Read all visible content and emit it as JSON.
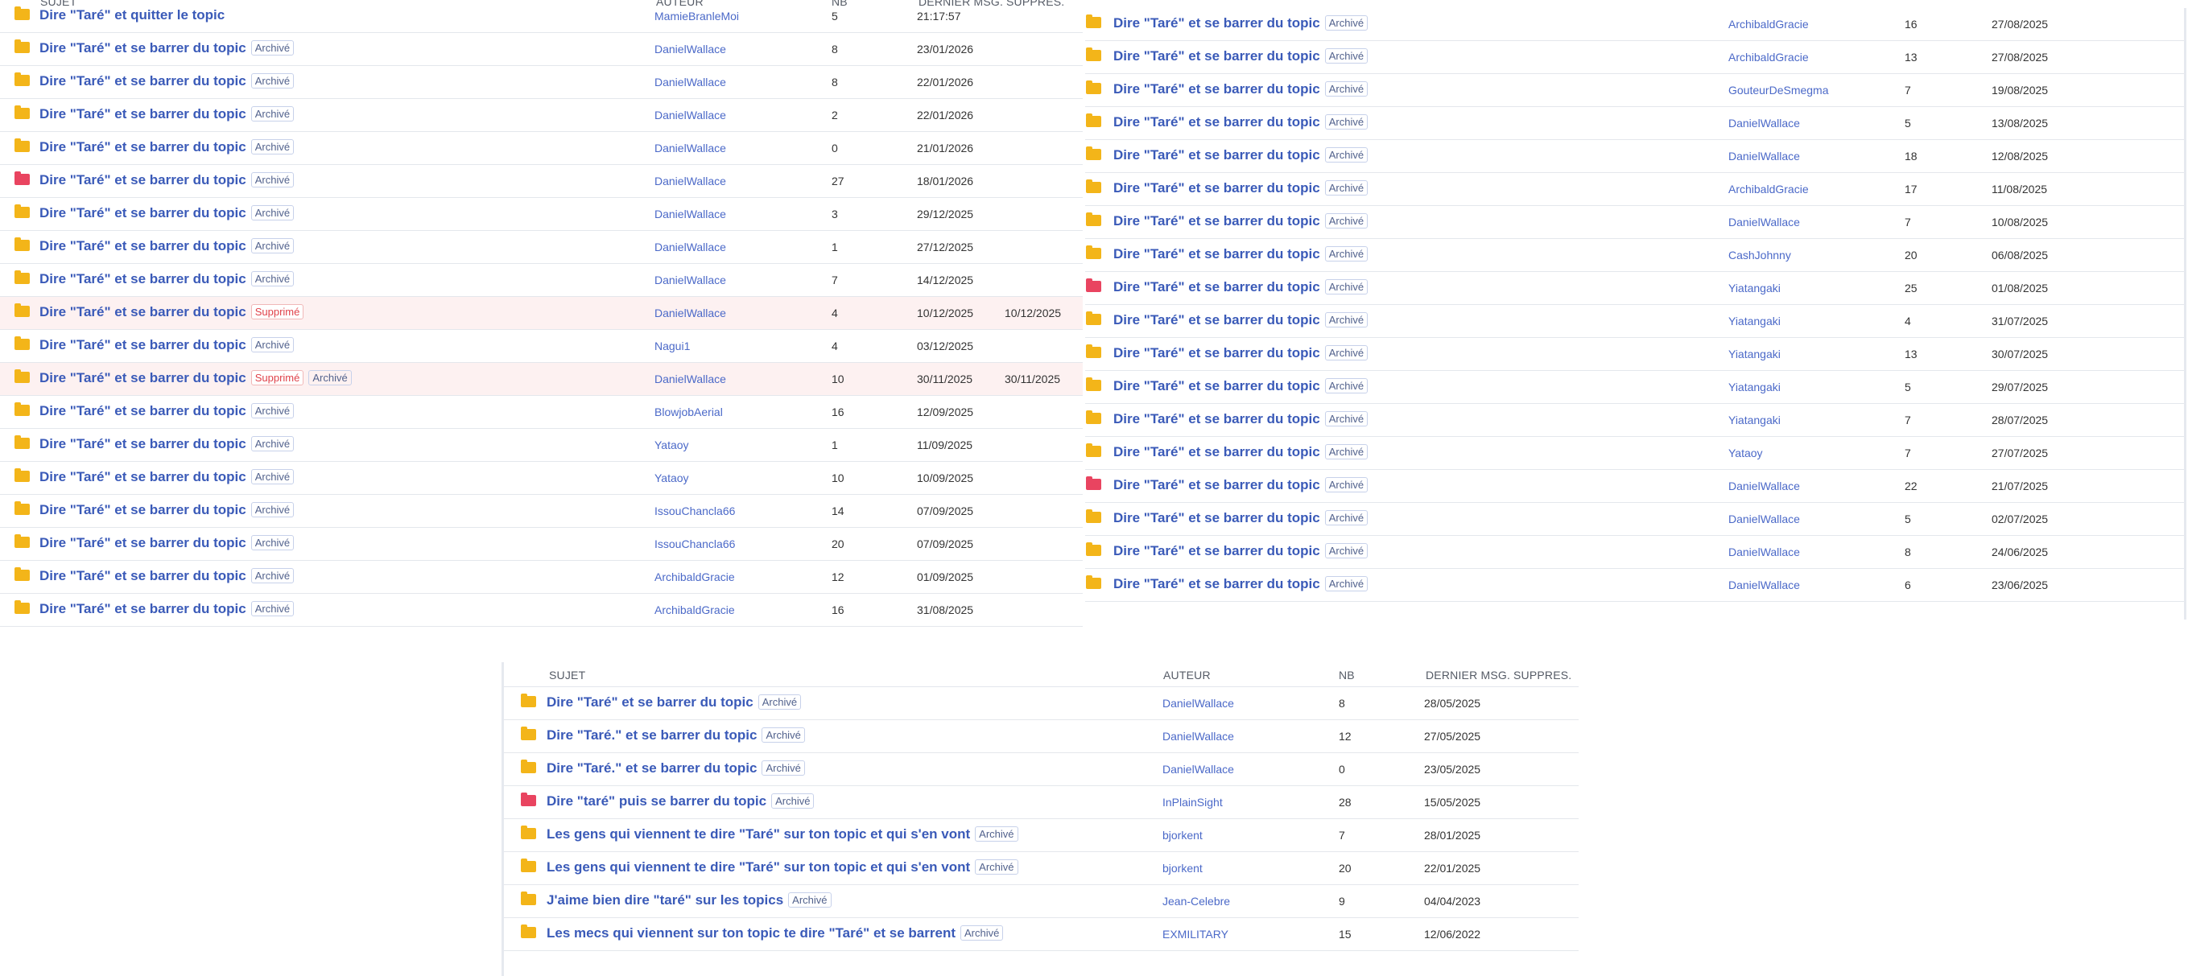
{
  "colors": {
    "link": "#3a5ab8",
    "author": "#4b69c8",
    "folder": "#f3b519",
    "folder_hot": "#e94460",
    "deleted_row": "#fdf1f1",
    "deleted_badge": "#e0424a"
  },
  "headers": {
    "subject": "SUJET",
    "author": "AUTEUR",
    "count": "NB",
    "last": "DERNIER MSG.",
    "deleted": "SUPPRES."
  },
  "icons": {
    "folder": "folder-icon",
    "folder_hot": "folder-hot-icon"
  },
  "panels": [
    {
      "id": "panel-a",
      "show_header": true,
      "rows": [
        {
          "title": "Dire \"Taré\" et quitter le topic",
          "badges": [],
          "author": "MamieBranleMoi",
          "nb": "5",
          "last": "21:17:57",
          "deleted": "",
          "hot": false
        },
        {
          "title": "Dire \"Taré\" et se barrer du topic",
          "badges": [
            "Archivé"
          ],
          "author": "DanielWallace",
          "nb": "8",
          "last": "23/01/2026",
          "deleted": "",
          "hot": false
        },
        {
          "title": "Dire \"Taré\" et se barrer du topic",
          "badges": [
            "Archivé"
          ],
          "author": "DanielWallace",
          "nb": "8",
          "last": "22/01/2026",
          "deleted": "",
          "hot": false
        },
        {
          "title": "Dire \"Taré\" et se barrer du topic",
          "badges": [
            "Archivé"
          ],
          "author": "DanielWallace",
          "nb": "2",
          "last": "22/01/2026",
          "deleted": "",
          "hot": false
        },
        {
          "title": "Dire \"Taré\" et se barrer du topic",
          "badges": [
            "Archivé"
          ],
          "author": "DanielWallace",
          "nb": "0",
          "last": "21/01/2026",
          "deleted": "",
          "hot": false
        },
        {
          "title": "Dire \"Taré\" et se barrer du topic",
          "badges": [
            "Archivé"
          ],
          "author": "DanielWallace",
          "nb": "27",
          "last": "18/01/2026",
          "deleted": "",
          "hot": true
        },
        {
          "title": "Dire \"Taré\" et se barrer du topic",
          "badges": [
            "Archivé"
          ],
          "author": "DanielWallace",
          "nb": "3",
          "last": "29/12/2025",
          "deleted": "",
          "hot": false
        },
        {
          "title": "Dire \"Taré\" et se barrer du topic",
          "badges": [
            "Archivé"
          ],
          "author": "DanielWallace",
          "nb": "1",
          "last": "27/12/2025",
          "deleted": "",
          "hot": false
        },
        {
          "title": "Dire \"Taré\" et se barrer du topic",
          "badges": [
            "Archivé"
          ],
          "author": "DanielWallace",
          "nb": "7",
          "last": "14/12/2025",
          "deleted": "",
          "hot": false
        },
        {
          "title": "Dire \"Taré\" et se barrer du topic",
          "badges": [
            "Supprimé"
          ],
          "author": "DanielWallace",
          "nb": "4",
          "last": "10/12/2025",
          "deleted": "10/12/2025",
          "hot": false
        },
        {
          "title": "Dire \"Taré\" et se barrer du topic",
          "badges": [
            "Archivé"
          ],
          "author": "Nagui1",
          "nb": "4",
          "last": "03/12/2025",
          "deleted": "",
          "hot": false
        },
        {
          "title": "Dire \"Taré\" et se barrer du topic",
          "badges": [
            "Supprimé",
            "Archivé"
          ],
          "author": "DanielWallace",
          "nb": "10",
          "last": "30/11/2025",
          "deleted": "30/11/2025",
          "hot": false
        },
        {
          "title": "Dire \"Taré\" et se barrer du topic",
          "badges": [
            "Archivé"
          ],
          "author": "BlowjobAerial",
          "nb": "16",
          "last": "12/09/2025",
          "deleted": "",
          "hot": false
        },
        {
          "title": "Dire \"Taré\" et se barrer du topic",
          "badges": [
            "Archivé"
          ],
          "author": "Yataoy",
          "nb": "1",
          "last": "11/09/2025",
          "deleted": "",
          "hot": false
        },
        {
          "title": "Dire \"Taré\" et se barrer du topic",
          "badges": [
            "Archivé"
          ],
          "author": "Yataoy",
          "nb": "10",
          "last": "10/09/2025",
          "deleted": "",
          "hot": false
        },
        {
          "title": "Dire \"Taré\" et se barrer du topic",
          "badges": [
            "Archivé"
          ],
          "author": "IssouChancla66",
          "nb": "14",
          "last": "07/09/2025",
          "deleted": "",
          "hot": false
        },
        {
          "title": "Dire \"Taré\" et se barrer du topic",
          "badges": [
            "Archivé"
          ],
          "author": "IssouChancla66",
          "nb": "20",
          "last": "07/09/2025",
          "deleted": "",
          "hot": false
        },
        {
          "title": "Dire \"Taré\" et se barrer du topic",
          "badges": [
            "Archivé"
          ],
          "author": "ArchibaldGracie",
          "nb": "12",
          "last": "01/09/2025",
          "deleted": "",
          "hot": false
        },
        {
          "title": "Dire \"Taré\" et se barrer du topic",
          "badges": [
            "Archivé"
          ],
          "author": "ArchibaldGracie",
          "nb": "16",
          "last": "31/08/2025",
          "deleted": "",
          "hot": false
        }
      ]
    },
    {
      "id": "panel-b",
      "show_header": false,
      "rows": [
        {
          "title": "Dire \"Taré\" et se barrer du topic",
          "badges": [
            "Archivé"
          ],
          "author": "ArchibaldGracie",
          "nb": "16",
          "last": "27/08/2025",
          "deleted": "",
          "hot": false
        },
        {
          "title": "Dire \"Taré\" et se barrer du topic",
          "badges": [
            "Archivé"
          ],
          "author": "ArchibaldGracie",
          "nb": "13",
          "last": "27/08/2025",
          "deleted": "",
          "hot": false
        },
        {
          "title": "Dire \"Taré\" et se barrer du topic",
          "badges": [
            "Archivé"
          ],
          "author": "GouteurDeSmegma",
          "nb": "7",
          "last": "19/08/2025",
          "deleted": "",
          "hot": false
        },
        {
          "title": "Dire \"Taré\" et se barrer du topic",
          "badges": [
            "Archivé"
          ],
          "author": "DanielWallace",
          "nb": "5",
          "last": "13/08/2025",
          "deleted": "",
          "hot": false
        },
        {
          "title": "Dire \"Taré\" et se barrer du topic",
          "badges": [
            "Archivé"
          ],
          "author": "DanielWallace",
          "nb": "18",
          "last": "12/08/2025",
          "deleted": "",
          "hot": false
        },
        {
          "title": "Dire \"Taré\" et se barrer du topic",
          "badges": [
            "Archivé"
          ],
          "author": "ArchibaldGracie",
          "nb": "17",
          "last": "11/08/2025",
          "deleted": "",
          "hot": false
        },
        {
          "title": "Dire \"Taré\" et se barrer du topic",
          "badges": [
            "Archivé"
          ],
          "author": "DanielWallace",
          "nb": "7",
          "last": "10/08/2025",
          "deleted": "",
          "hot": false
        },
        {
          "title": "Dire \"Taré\" et se barrer du topic",
          "badges": [
            "Archivé"
          ],
          "author": "CashJohnny",
          "nb": "20",
          "last": "06/08/2025",
          "deleted": "",
          "hot": false
        },
        {
          "title": "Dire \"Taré\" et se barrer du topic",
          "badges": [
            "Archivé"
          ],
          "author": "Yiatangaki",
          "nb": "25",
          "last": "01/08/2025",
          "deleted": "",
          "hot": true
        },
        {
          "title": "Dire \"Taré\" et se barrer du topic",
          "badges": [
            "Archivé"
          ],
          "author": "Yiatangaki",
          "nb": "4",
          "last": "31/07/2025",
          "deleted": "",
          "hot": false
        },
        {
          "title": "Dire \"Taré\" et se barrer du topic",
          "badges": [
            "Archivé"
          ],
          "author": "Yiatangaki",
          "nb": "13",
          "last": "30/07/2025",
          "deleted": "",
          "hot": false
        },
        {
          "title": "Dire \"Taré\" et se barrer du topic",
          "badges": [
            "Archivé"
          ],
          "author": "Yiatangaki",
          "nb": "5",
          "last": "29/07/2025",
          "deleted": "",
          "hot": false
        },
        {
          "title": "Dire \"Taré\" et se barrer du topic",
          "badges": [
            "Archivé"
          ],
          "author": "Yiatangaki",
          "nb": "7",
          "last": "28/07/2025",
          "deleted": "",
          "hot": false
        },
        {
          "title": "Dire \"Taré\" et se barrer du topic",
          "badges": [
            "Archivé"
          ],
          "author": "Yataoy",
          "nb": "7",
          "last": "27/07/2025",
          "deleted": "",
          "hot": false
        },
        {
          "title": "Dire \"Taré\" et se barrer du topic",
          "badges": [
            "Archivé"
          ],
          "author": "DanielWallace",
          "nb": "22",
          "last": "21/07/2025",
          "deleted": "",
          "hot": true
        },
        {
          "title": "Dire \"Taré\" et se barrer du topic",
          "badges": [
            "Archivé"
          ],
          "author": "DanielWallace",
          "nb": "5",
          "last": "02/07/2025",
          "deleted": "",
          "hot": false
        },
        {
          "title": "Dire \"Taré\" et se barrer du topic",
          "badges": [
            "Archivé"
          ],
          "author": "DanielWallace",
          "nb": "8",
          "last": "24/06/2025",
          "deleted": "",
          "hot": false
        },
        {
          "title": "Dire \"Taré\" et se barrer du topic",
          "badges": [
            "Archivé"
          ],
          "author": "DanielWallace",
          "nb": "6",
          "last": "23/06/2025",
          "deleted": "",
          "hot": false
        }
      ]
    },
    {
      "id": "panel-c",
      "show_header": true,
      "rows": [
        {
          "title": "Dire \"Taré\" et se barrer du topic",
          "badges": [
            "Archivé"
          ],
          "author": "DanielWallace",
          "nb": "8",
          "last": "28/05/2025",
          "deleted": "",
          "hot": false
        },
        {
          "title": "Dire \"Taré.\" et se barrer du topic",
          "badges": [
            "Archivé"
          ],
          "author": "DanielWallace",
          "nb": "12",
          "last": "27/05/2025",
          "deleted": "",
          "hot": false
        },
        {
          "title": "Dire \"Taré.\" et se barrer du topic",
          "badges": [
            "Archivé"
          ],
          "author": "DanielWallace",
          "nb": "0",
          "last": "23/05/2025",
          "deleted": "",
          "hot": false
        },
        {
          "title": "Dire \"taré\" puis se barrer du topic",
          "badges": [
            "Archivé"
          ],
          "author": "InPlainSight",
          "nb": "28",
          "last": "15/05/2025",
          "deleted": "",
          "hot": true
        },
        {
          "title": "Les gens qui viennent te dire \"Taré\" sur ton topic et qui s'en vont",
          "badges": [
            "Archivé"
          ],
          "author": "bjorkent",
          "nb": "7",
          "last": "28/01/2025",
          "deleted": "",
          "hot": false
        },
        {
          "title": "Les gens qui viennent te dire \"Taré\" sur ton topic et qui s'en vont",
          "badges": [
            "Archivé"
          ],
          "author": "bjorkent",
          "nb": "20",
          "last": "22/01/2025",
          "deleted": "",
          "hot": false
        },
        {
          "title": "J'aime bien dire \"taré\" sur les topics",
          "badges": [
            "Archivé"
          ],
          "author": "Jean-Celebre",
          "nb": "9",
          "last": "04/04/2023",
          "deleted": "",
          "hot": false
        },
        {
          "title": "Les mecs qui viennent sur ton topic te dire \"Taré\" et se barrent",
          "badges": [
            "Archivé"
          ],
          "author": "EXMILITARY",
          "nb": "15",
          "last": "12/06/2022",
          "deleted": "",
          "hot": false
        }
      ]
    }
  ]
}
